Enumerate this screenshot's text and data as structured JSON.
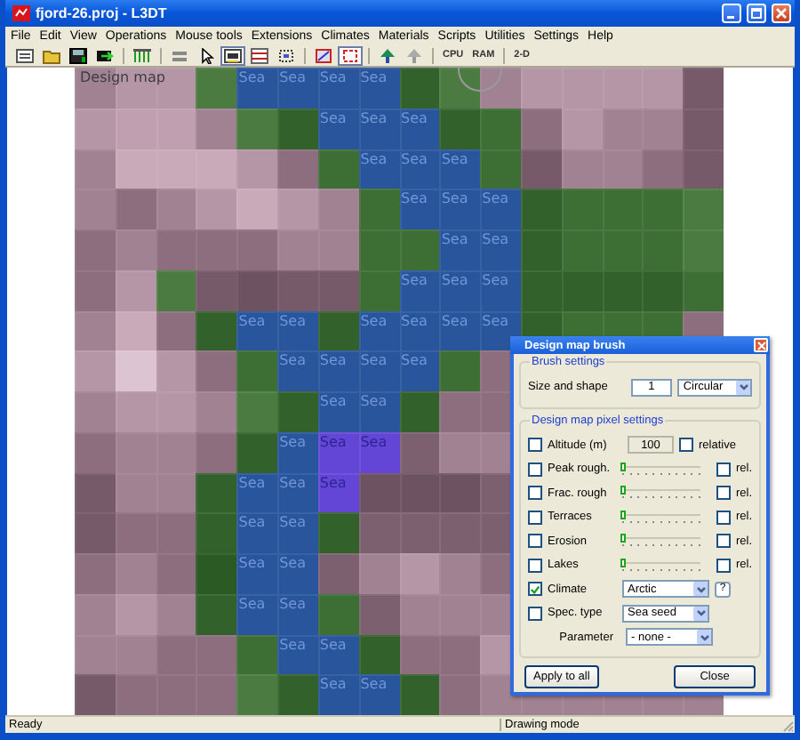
{
  "window": {
    "title": "fjord-26.proj - L3DT"
  },
  "menu": [
    "File",
    "Edit",
    "View",
    "Operations",
    "Mouse tools",
    "Extensions",
    "Climates",
    "Materials",
    "Scripts",
    "Utilities",
    "Settings",
    "Help"
  ],
  "toolbar": [
    [
      {
        "selected": false
      },
      {
        "selected": false
      },
      {
        "selected": false
      },
      {
        "selected": false
      }
    ],
    [
      {
        "selected": false
      }
    ],
    [
      {
        "selected": false
      },
      {
        "selected": false
      },
      {
        "selected": true
      },
      {
        "selected": false
      },
      {
        "selected": false
      }
    ],
    [
      {
        "selected": false
      },
      {
        "selected": true
      }
    ],
    [
      {
        "selected": false
      },
      {
        "selected": false
      }
    ],
    [
      {
        "label": "CPU",
        "selected": false
      },
      {
        "label": "RAM",
        "selected": false
      }
    ],
    [
      {
        "label": "2-D",
        "selected": false
      }
    ]
  ],
  "map": {
    "title": "Design map",
    "rows": [
      [
        {
          "kind": "land",
          "color": "#a08292"
        },
        {
          "kind": "land",
          "color": "#b596a6"
        },
        {
          "kind": "land",
          "color": "#b596a6"
        },
        {
          "kind": "forest",
          "color": "#4b7b40"
        },
        {
          "kind": "sea",
          "label": "Sea"
        },
        {
          "kind": "sea",
          "label": "Sea"
        },
        {
          "kind": "sea",
          "label": "Sea"
        },
        {
          "kind": "sea",
          "label": "Sea"
        },
        {
          "kind": "forest",
          "color": "#33612b"
        },
        {
          "kind": "forest",
          "color": "#4b7b40"
        },
        {
          "kind": "land",
          "color": "#a08292"
        },
        {
          "kind": "land",
          "color": "#b596a6"
        },
        {
          "kind": "land",
          "color": "#b596a6"
        },
        {
          "kind": "land",
          "color": "#b596a6"
        },
        {
          "kind": "land",
          "color": "#b596a6"
        },
        {
          "kind": "land",
          "color": "#765a6a"
        }
      ],
      [
        {
          "kind": "land",
          "color": "#b596a6"
        },
        {
          "kind": "land",
          "color": "#c0a0b0"
        },
        {
          "kind": "land",
          "color": "#c0a0b0"
        },
        {
          "kind": "land",
          "color": "#a08292"
        },
        {
          "kind": "forest",
          "color": "#4b7b40"
        },
        {
          "kind": "forest",
          "color": "#33612b"
        },
        {
          "kind": "sea",
          "label": "Sea"
        },
        {
          "kind": "sea",
          "label": "Sea"
        },
        {
          "kind": "sea",
          "label": "Sea"
        },
        {
          "kind": "forest",
          "color": "#33612b"
        },
        {
          "kind": "forest",
          "color": "#3d6e34"
        },
        {
          "kind": "land",
          "color": "#8c6e7e"
        },
        {
          "kind": "land",
          "color": "#b596a6"
        },
        {
          "kind": "land",
          "color": "#a08292"
        },
        {
          "kind": "land",
          "color": "#a08292"
        },
        {
          "kind": "land",
          "color": "#765a6a"
        }
      ],
      [
        {
          "kind": "land",
          "color": "#a08292"
        },
        {
          "kind": "land",
          "color": "#c9aab9"
        },
        {
          "kind": "land",
          "color": "#c9aab9"
        },
        {
          "kind": "land",
          "color": "#c9aab9"
        },
        {
          "kind": "land",
          "color": "#b596a6"
        },
        {
          "kind": "land",
          "color": "#8c6e7e"
        },
        {
          "kind": "forest",
          "color": "#3d6e34"
        },
        {
          "kind": "sea",
          "label": "Sea"
        },
        {
          "kind": "sea",
          "label": "Sea"
        },
        {
          "kind": "sea",
          "label": "Sea"
        },
        {
          "kind": "forest",
          "color": "#3d6e34"
        },
        {
          "kind": "land",
          "color": "#765a6a"
        },
        {
          "kind": "land",
          "color": "#a08292"
        },
        {
          "kind": "land",
          "color": "#a08292"
        },
        {
          "kind": "land",
          "color": "#8c6e7e"
        },
        {
          "kind": "land",
          "color": "#765a6a"
        }
      ],
      [
        {
          "kind": "land",
          "color": "#a08292"
        },
        {
          "kind": "land",
          "color": "#8c6e7e"
        },
        {
          "kind": "land",
          "color": "#a08292"
        },
        {
          "kind": "land",
          "color": "#b596a6"
        },
        {
          "kind": "land",
          "color": "#c9aab9"
        },
        {
          "kind": "land",
          "color": "#b596a6"
        },
        {
          "kind": "land",
          "color": "#a08292"
        },
        {
          "kind": "forest",
          "color": "#3d6e34"
        },
        {
          "kind": "sea",
          "label": "Sea"
        },
        {
          "kind": "sea",
          "label": "Sea"
        },
        {
          "kind": "sea",
          "label": "Sea"
        },
        {
          "kind": "forest",
          "color": "#33612b"
        },
        {
          "kind": "forest",
          "color": "#3d6e34"
        },
        {
          "kind": "forest",
          "color": "#3d6e34"
        },
        {
          "kind": "forest",
          "color": "#3d6e34"
        },
        {
          "kind": "forest",
          "color": "#4b7b40"
        }
      ],
      [
        {
          "kind": "land",
          "color": "#8c6e7e"
        },
        {
          "kind": "land",
          "color": "#a08292"
        },
        {
          "kind": "land",
          "color": "#8c6e7e"
        },
        {
          "kind": "land",
          "color": "#8c6e7e"
        },
        {
          "kind": "land",
          "color": "#8c6e7e"
        },
        {
          "kind": "land",
          "color": "#a08292"
        },
        {
          "kind": "land",
          "color": "#a08292"
        },
        {
          "kind": "forest",
          "color": "#3d6e34"
        },
        {
          "kind": "forest",
          "color": "#3d6e34"
        },
        {
          "kind": "sea",
          "label": "Sea"
        },
        {
          "kind": "sea",
          "label": "Sea"
        },
        {
          "kind": "forest",
          "color": "#33612b"
        },
        {
          "kind": "forest",
          "color": "#3d6e34"
        },
        {
          "kind": "forest",
          "color": "#3d6e34"
        },
        {
          "kind": "forest",
          "color": "#3d6e34"
        },
        {
          "kind": "forest",
          "color": "#4b7b40"
        }
      ],
      [
        {
          "kind": "land",
          "color": "#8c6e7e"
        },
        {
          "kind": "land",
          "color": "#b596a6"
        },
        {
          "kind": "forest",
          "color": "#4b7b40"
        },
        {
          "kind": "land",
          "color": "#765a6a"
        },
        {
          "kind": "land",
          "color": "#6d5262"
        },
        {
          "kind": "land",
          "color": "#765a6a"
        },
        {
          "kind": "land",
          "color": "#765a6a"
        },
        {
          "kind": "forest",
          "color": "#3d6e34"
        },
        {
          "kind": "sea",
          "label": "Sea"
        },
        {
          "kind": "sea",
          "label": "Sea"
        },
        {
          "kind": "sea",
          "label": "Sea"
        },
        {
          "kind": "forest",
          "color": "#33612b"
        },
        {
          "kind": "forest",
          "color": "#33612b"
        },
        {
          "kind": "forest",
          "color": "#33612b"
        },
        {
          "kind": "forest",
          "color": "#33612b"
        },
        {
          "kind": "forest",
          "color": "#3d6e34"
        }
      ],
      [
        {
          "kind": "land",
          "color": "#a08292"
        },
        {
          "kind": "land",
          "color": "#c9aab9"
        },
        {
          "kind": "land",
          "color": "#8c6e7e"
        },
        {
          "kind": "forest",
          "color": "#33612b"
        },
        {
          "kind": "sea",
          "label": "Sea"
        },
        {
          "kind": "sea",
          "label": "Sea"
        },
        {
          "kind": "forest",
          "color": "#33612b"
        },
        {
          "kind": "sea",
          "label": "Sea"
        },
        {
          "kind": "sea",
          "label": "Sea"
        },
        {
          "kind": "sea",
          "label": "Sea"
        },
        {
          "kind": "sea",
          "label": "Sea"
        },
        {
          "kind": "forest",
          "color": "#33612b"
        },
        {
          "kind": "forest",
          "color": "#3d6e34"
        },
        {
          "kind": "forest",
          "color": "#3d6e34"
        },
        {
          "kind": "forest",
          "color": "#3d6e34"
        },
        {
          "kind": "land",
          "color": "#8c6e7e"
        }
      ],
      [
        {
          "kind": "land",
          "color": "#b596a6"
        },
        {
          "kind": "land",
          "color": "#dcc4d2"
        },
        {
          "kind": "land",
          "color": "#b596a6"
        },
        {
          "kind": "land",
          "color": "#8c6e7e"
        },
        {
          "kind": "forest",
          "color": "#3d6e34"
        },
        {
          "kind": "sea",
          "label": "Sea"
        },
        {
          "kind": "sea",
          "label": "Sea"
        },
        {
          "kind": "sea",
          "label": "Sea"
        },
        {
          "kind": "sea",
          "label": "Sea"
        },
        {
          "kind": "forest",
          "color": "#3d6e34"
        },
        {
          "kind": "land",
          "color": "#8c6e7e"
        }
      ],
      [
        {
          "kind": "land",
          "color": "#a08292"
        },
        {
          "kind": "land",
          "color": "#b596a6"
        },
        {
          "kind": "land",
          "color": "#b596a6"
        },
        {
          "kind": "land",
          "color": "#a08292"
        },
        {
          "kind": "forest",
          "color": "#4b7b40"
        },
        {
          "kind": "forest",
          "color": "#33612b"
        },
        {
          "kind": "sea",
          "label": "Sea"
        },
        {
          "kind": "sea",
          "label": "Sea"
        },
        {
          "kind": "forest",
          "color": "#33612b"
        },
        {
          "kind": "land",
          "color": "#8c6e7e"
        },
        {
          "kind": "land",
          "color": "#8c6e7e"
        }
      ],
      [
        {
          "kind": "land",
          "color": "#8c6e7e"
        },
        {
          "kind": "land",
          "color": "#a08292"
        },
        {
          "kind": "land",
          "color": "#a08292"
        },
        {
          "kind": "land",
          "color": "#8c6e7e"
        },
        {
          "kind": "forest",
          "color": "#33612b"
        },
        {
          "kind": "sea",
          "label": "Sea"
        },
        {
          "kind": "brush",
          "label": "Sea"
        },
        {
          "kind": "brush",
          "label": "Sea"
        },
        {
          "kind": "land",
          "color": "#7d6070"
        },
        {
          "kind": "land",
          "color": "#a08292"
        },
        {
          "kind": "land",
          "color": "#a08292"
        }
      ],
      [
        {
          "kind": "land",
          "color": "#765a6a"
        },
        {
          "kind": "land",
          "color": "#a08292"
        },
        {
          "kind": "land",
          "color": "#a08292"
        },
        {
          "kind": "forest",
          "color": "#33612b"
        },
        {
          "kind": "sea",
          "label": "Sea"
        },
        {
          "kind": "sea",
          "label": "Sea"
        },
        {
          "kind": "brush",
          "label": "Sea"
        },
        {
          "kind": "land",
          "color": "#6d5262"
        },
        {
          "kind": "land",
          "color": "#6d5262"
        },
        {
          "kind": "land",
          "color": "#6d5262"
        },
        {
          "kind": "land",
          "color": "#7d6070"
        }
      ],
      [
        {
          "kind": "land",
          "color": "#765a6a"
        },
        {
          "kind": "land",
          "color": "#8c6e7e"
        },
        {
          "kind": "land",
          "color": "#8c6e7e"
        },
        {
          "kind": "forest",
          "color": "#33612b"
        },
        {
          "kind": "sea",
          "label": "Sea"
        },
        {
          "kind": "sea",
          "label": "Sea"
        },
        {
          "kind": "forest",
          "color": "#33612b"
        },
        {
          "kind": "land",
          "color": "#7d6070"
        },
        {
          "kind": "land",
          "color": "#7d6070"
        },
        {
          "kind": "land",
          "color": "#7d6070"
        },
        {
          "kind": "land",
          "color": "#7d6070"
        }
      ],
      [
        {
          "kind": "land",
          "color": "#8c6e7e"
        },
        {
          "kind": "land",
          "color": "#a08292"
        },
        {
          "kind": "land",
          "color": "#8c6e7e"
        },
        {
          "kind": "forest",
          "color": "#2c5a24"
        },
        {
          "kind": "sea",
          "label": "Sea"
        },
        {
          "kind": "sea",
          "label": "Sea"
        },
        {
          "kind": "land",
          "color": "#7d6070"
        },
        {
          "kind": "land",
          "color": "#a08292"
        },
        {
          "kind": "land",
          "color": "#b596a6"
        },
        {
          "kind": "land",
          "color": "#a08292"
        },
        {
          "kind": "land",
          "color": "#8c6e7e"
        }
      ],
      [
        {
          "kind": "land",
          "color": "#a08292"
        },
        {
          "kind": "land",
          "color": "#b596a6"
        },
        {
          "kind": "land",
          "color": "#a08292"
        },
        {
          "kind": "forest",
          "color": "#33612b"
        },
        {
          "kind": "sea",
          "label": "Sea"
        },
        {
          "kind": "sea",
          "label": "Sea"
        },
        {
          "kind": "forest",
          "color": "#3d6e34"
        },
        {
          "kind": "land",
          "color": "#7d6070"
        },
        {
          "kind": "land",
          "color": "#a08292"
        },
        {
          "kind": "land",
          "color": "#a08292"
        },
        {
          "kind": "land",
          "color": "#a08292"
        }
      ],
      [
        {
          "kind": "land",
          "color": "#a08292"
        },
        {
          "kind": "land",
          "color": "#a08292"
        },
        {
          "kind": "land",
          "color": "#8c6e7e"
        },
        {
          "kind": "land",
          "color": "#8c6e7e"
        },
        {
          "kind": "forest",
          "color": "#3d6e34"
        },
        {
          "kind": "sea",
          "label": "Sea"
        },
        {
          "kind": "sea",
          "label": "Sea"
        },
        {
          "kind": "forest",
          "color": "#33612b"
        },
        {
          "kind": "land",
          "color": "#8c6e7e"
        },
        {
          "kind": "land",
          "color": "#8c6e7e"
        },
        {
          "kind": "land",
          "color": "#b596a6"
        }
      ],
      [
        {
          "kind": "land",
          "color": "#765a6a"
        },
        {
          "kind": "land",
          "color": "#8c6e7e"
        },
        {
          "kind": "land",
          "color": "#8c6e7e"
        },
        {
          "kind": "land",
          "color": "#8c6e7e"
        },
        {
          "kind": "forest",
          "color": "#4b7b40"
        },
        {
          "kind": "forest",
          "color": "#33612b"
        },
        {
          "kind": "sea",
          "label": "Sea"
        },
        {
          "kind": "sea",
          "label": "Sea"
        },
        {
          "kind": "forest",
          "color": "#33612b"
        },
        {
          "kind": "land",
          "color": "#8c6e7e"
        },
        {
          "kind": "land",
          "color": "#a08292"
        },
        {
          "kind": "land",
          "color": "#a08292"
        },
        {
          "kind": "land",
          "color": "#a08292"
        },
        {
          "kind": "land",
          "color": "#a08292"
        },
        {
          "kind": "land",
          "color": "#a08292"
        },
        {
          "kind": "land",
          "color": "#a08292"
        }
      ]
    ]
  },
  "dialog": {
    "title": "Design map brush",
    "brush_group": {
      "title": "Brush settings",
      "label": "Size and shape",
      "size": "1",
      "shape": "Circular"
    },
    "pixel_group": {
      "title": "Design map pixel settings",
      "rows": [
        {
          "kind": "number",
          "label": "Altitude (m)",
          "checked": false,
          "value": "100",
          "option": "relative",
          "option_checked": false
        },
        {
          "kind": "slider",
          "label": "Peak rough.",
          "checked": false,
          "level": 0,
          "option": "rel.",
          "option_checked": false
        },
        {
          "kind": "slider",
          "label": "Frac. rough",
          "checked": false,
          "level": 0,
          "option": "rel.",
          "option_checked": false
        },
        {
          "kind": "slider",
          "label": "Terraces",
          "checked": false,
          "level": 0,
          "option": "rel.",
          "option_checked": false
        },
        {
          "kind": "slider",
          "label": "Erosion",
          "checked": false,
          "level": 0,
          "option": "rel.",
          "option_checked": false
        },
        {
          "kind": "slider",
          "label": "Lakes",
          "checked": false,
          "level": 0,
          "option": "rel.",
          "option_checked": false
        },
        {
          "kind": "dropdown",
          "label": "Climate",
          "checked": true,
          "value": "Arctic",
          "help": "?"
        },
        {
          "kind": "dropdown",
          "label": "Spec. type",
          "checked": false,
          "value": "Sea seed"
        },
        {
          "kind": "parameter",
          "label": "Parameter",
          "value": "- none -"
        }
      ]
    },
    "buttons": [
      "Apply to all",
      "Close"
    ]
  },
  "status_bar": [
    "Ready",
    "Drawing mode"
  ]
}
